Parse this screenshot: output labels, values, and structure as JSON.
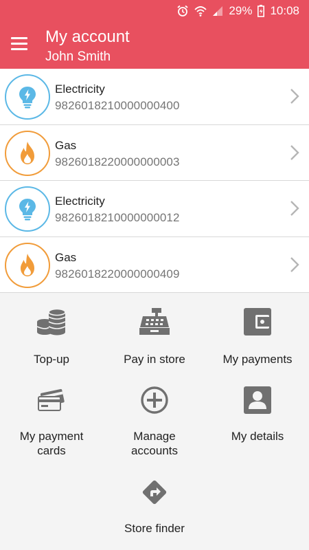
{
  "status_bar": {
    "battery": "29%",
    "time": "10:08"
  },
  "header": {
    "title": "My account",
    "subtitle": "John Smith"
  },
  "accounts": [
    {
      "type": "Electricity",
      "number": "9826018210000000400"
    },
    {
      "type": "Gas",
      "number": "9826018220000000003"
    },
    {
      "type": "Electricity",
      "number": "9826018210000000012"
    },
    {
      "type": "Gas",
      "number": "9826018220000000409"
    }
  ],
  "actions": {
    "topup": "Top-up",
    "pay_in_store": "Pay in store",
    "my_payments": "My payments",
    "my_payment_cards_1": "My payment",
    "my_payment_cards_2": "cards",
    "manage_accounts_1": "Manage",
    "manage_accounts_2": "accounts",
    "my_details": "My details",
    "store_finder": "Store finder"
  },
  "colors": {
    "brand": "#e8505f",
    "electricity": "#5bb8e6",
    "gas": "#f19c3a",
    "icon_grey": "#707070"
  }
}
